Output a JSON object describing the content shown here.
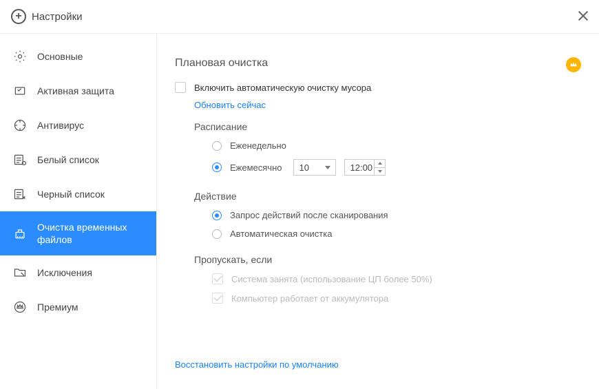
{
  "title": "Настройки",
  "sidebar": [
    {
      "id": "general",
      "label": "Основные"
    },
    {
      "id": "active-protection",
      "label": "Активная защита"
    },
    {
      "id": "antivirus",
      "label": "Антивирус"
    },
    {
      "id": "whitelist",
      "label": "Белый список"
    },
    {
      "id": "blacklist",
      "label": "Черный список"
    },
    {
      "id": "temp-clean",
      "label": "Очистка временных файлов"
    },
    {
      "id": "exclusions",
      "label": "Исключения"
    },
    {
      "id": "premium",
      "label": "Премиум"
    }
  ],
  "content": {
    "title": "Плановая очистка",
    "enable_label": "Включить автоматическую очистку мусора",
    "update_now": "Обновить сейчас",
    "schedule": {
      "title": "Расписание",
      "weekly": "Еженедельно",
      "monthly": "Ежемесячно",
      "day": "10",
      "time": "12:00"
    },
    "action": {
      "title": "Действие",
      "prompt": "Запрос действий после сканирования",
      "auto": "Автоматическая очистка"
    },
    "skip": {
      "title": "Пропускать, если",
      "cpu_busy": "Система занята (использование ЦП более 50%)",
      "on_battery": "Компьютер работает от аккумулятора"
    },
    "restore": "Восстановить настройки по умолчанию"
  }
}
